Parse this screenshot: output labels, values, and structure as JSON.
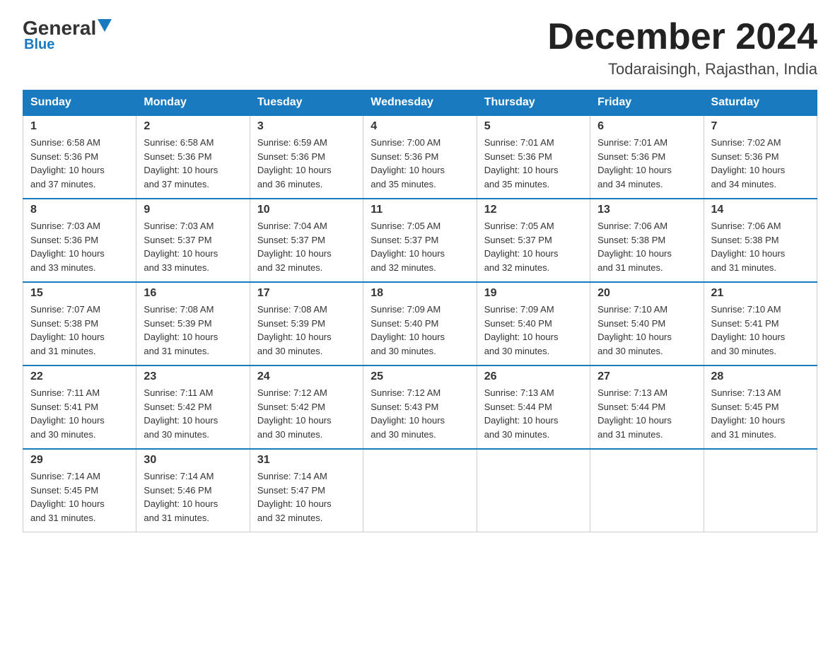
{
  "logo": {
    "general": "General",
    "triangle": "",
    "blue": "Blue"
  },
  "title": {
    "month_year": "December 2024",
    "location": "Todaraisingh, Rajasthan, India"
  },
  "days_of_week": [
    "Sunday",
    "Monday",
    "Tuesday",
    "Wednesday",
    "Thursday",
    "Friday",
    "Saturday"
  ],
  "weeks": [
    [
      {
        "day": "1",
        "sunrise": "6:58 AM",
        "sunset": "5:36 PM",
        "daylight": "10 hours and 37 minutes."
      },
      {
        "day": "2",
        "sunrise": "6:58 AM",
        "sunset": "5:36 PM",
        "daylight": "10 hours and 37 minutes."
      },
      {
        "day": "3",
        "sunrise": "6:59 AM",
        "sunset": "5:36 PM",
        "daylight": "10 hours and 36 minutes."
      },
      {
        "day": "4",
        "sunrise": "7:00 AM",
        "sunset": "5:36 PM",
        "daylight": "10 hours and 35 minutes."
      },
      {
        "day": "5",
        "sunrise": "7:01 AM",
        "sunset": "5:36 PM",
        "daylight": "10 hours and 35 minutes."
      },
      {
        "day": "6",
        "sunrise": "7:01 AM",
        "sunset": "5:36 PM",
        "daylight": "10 hours and 34 minutes."
      },
      {
        "day": "7",
        "sunrise": "7:02 AM",
        "sunset": "5:36 PM",
        "daylight": "10 hours and 34 minutes."
      }
    ],
    [
      {
        "day": "8",
        "sunrise": "7:03 AM",
        "sunset": "5:36 PM",
        "daylight": "10 hours and 33 minutes."
      },
      {
        "day": "9",
        "sunrise": "7:03 AM",
        "sunset": "5:37 PM",
        "daylight": "10 hours and 33 minutes."
      },
      {
        "day": "10",
        "sunrise": "7:04 AM",
        "sunset": "5:37 PM",
        "daylight": "10 hours and 32 minutes."
      },
      {
        "day": "11",
        "sunrise": "7:05 AM",
        "sunset": "5:37 PM",
        "daylight": "10 hours and 32 minutes."
      },
      {
        "day": "12",
        "sunrise": "7:05 AM",
        "sunset": "5:37 PM",
        "daylight": "10 hours and 32 minutes."
      },
      {
        "day": "13",
        "sunrise": "7:06 AM",
        "sunset": "5:38 PM",
        "daylight": "10 hours and 31 minutes."
      },
      {
        "day": "14",
        "sunrise": "7:06 AM",
        "sunset": "5:38 PM",
        "daylight": "10 hours and 31 minutes."
      }
    ],
    [
      {
        "day": "15",
        "sunrise": "7:07 AM",
        "sunset": "5:38 PM",
        "daylight": "10 hours and 31 minutes."
      },
      {
        "day": "16",
        "sunrise": "7:08 AM",
        "sunset": "5:39 PM",
        "daylight": "10 hours and 31 minutes."
      },
      {
        "day": "17",
        "sunrise": "7:08 AM",
        "sunset": "5:39 PM",
        "daylight": "10 hours and 30 minutes."
      },
      {
        "day": "18",
        "sunrise": "7:09 AM",
        "sunset": "5:40 PM",
        "daylight": "10 hours and 30 minutes."
      },
      {
        "day": "19",
        "sunrise": "7:09 AM",
        "sunset": "5:40 PM",
        "daylight": "10 hours and 30 minutes."
      },
      {
        "day": "20",
        "sunrise": "7:10 AM",
        "sunset": "5:40 PM",
        "daylight": "10 hours and 30 minutes."
      },
      {
        "day": "21",
        "sunrise": "7:10 AM",
        "sunset": "5:41 PM",
        "daylight": "10 hours and 30 minutes."
      }
    ],
    [
      {
        "day": "22",
        "sunrise": "7:11 AM",
        "sunset": "5:41 PM",
        "daylight": "10 hours and 30 minutes."
      },
      {
        "day": "23",
        "sunrise": "7:11 AM",
        "sunset": "5:42 PM",
        "daylight": "10 hours and 30 minutes."
      },
      {
        "day": "24",
        "sunrise": "7:12 AM",
        "sunset": "5:42 PM",
        "daylight": "10 hours and 30 minutes."
      },
      {
        "day": "25",
        "sunrise": "7:12 AM",
        "sunset": "5:43 PM",
        "daylight": "10 hours and 30 minutes."
      },
      {
        "day": "26",
        "sunrise": "7:13 AM",
        "sunset": "5:44 PM",
        "daylight": "10 hours and 30 minutes."
      },
      {
        "day": "27",
        "sunrise": "7:13 AM",
        "sunset": "5:44 PM",
        "daylight": "10 hours and 31 minutes."
      },
      {
        "day": "28",
        "sunrise": "7:13 AM",
        "sunset": "5:45 PM",
        "daylight": "10 hours and 31 minutes."
      }
    ],
    [
      {
        "day": "29",
        "sunrise": "7:14 AM",
        "sunset": "5:45 PM",
        "daylight": "10 hours and 31 minutes."
      },
      {
        "day": "30",
        "sunrise": "7:14 AM",
        "sunset": "5:46 PM",
        "daylight": "10 hours and 31 minutes."
      },
      {
        "day": "31",
        "sunrise": "7:14 AM",
        "sunset": "5:47 PM",
        "daylight": "10 hours and 32 minutes."
      },
      null,
      null,
      null,
      null
    ]
  ],
  "labels": {
    "sunrise": "Sunrise:",
    "sunset": "Sunset:",
    "daylight": "Daylight:"
  }
}
